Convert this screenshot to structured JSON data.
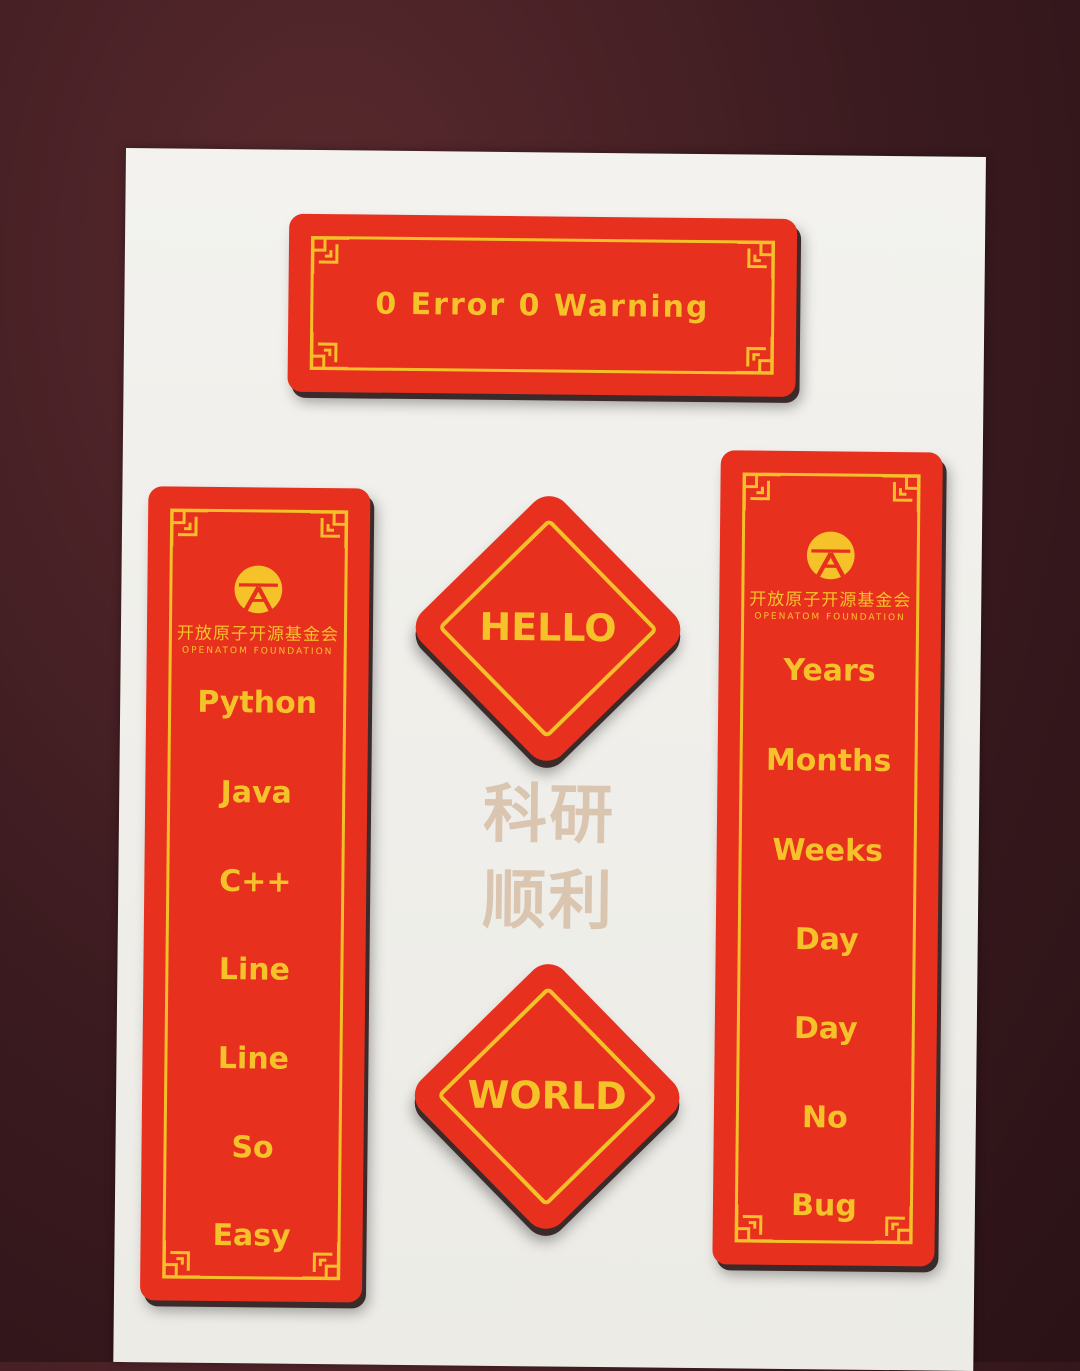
{
  "top_plaque": {
    "text": "0 Error 0 Warning"
  },
  "left_plaque": {
    "logo_cn": "开放原子开源基金会",
    "logo_en": "OPENATOM FOUNDATION",
    "items": [
      "Python",
      "Java",
      "C++",
      "Line",
      "Line",
      "So",
      "Easy"
    ]
  },
  "right_plaque": {
    "logo_cn": "开放原子开源基金会",
    "logo_en": "OPENATOM FOUNDATION",
    "items": [
      "Years",
      "Months",
      "Weeks",
      "Day",
      "Day",
      "No",
      "Bug"
    ]
  },
  "diamond_top": {
    "text": "HELLO"
  },
  "diamond_bottom": {
    "text": "WORLD"
  },
  "blessing": {
    "line1": "科研",
    "line2": "顺利"
  },
  "colors": {
    "plaque_red": "#e8301f",
    "gold": "#f5c22a",
    "card": "#f0efea",
    "background": "#3a1a1f"
  }
}
